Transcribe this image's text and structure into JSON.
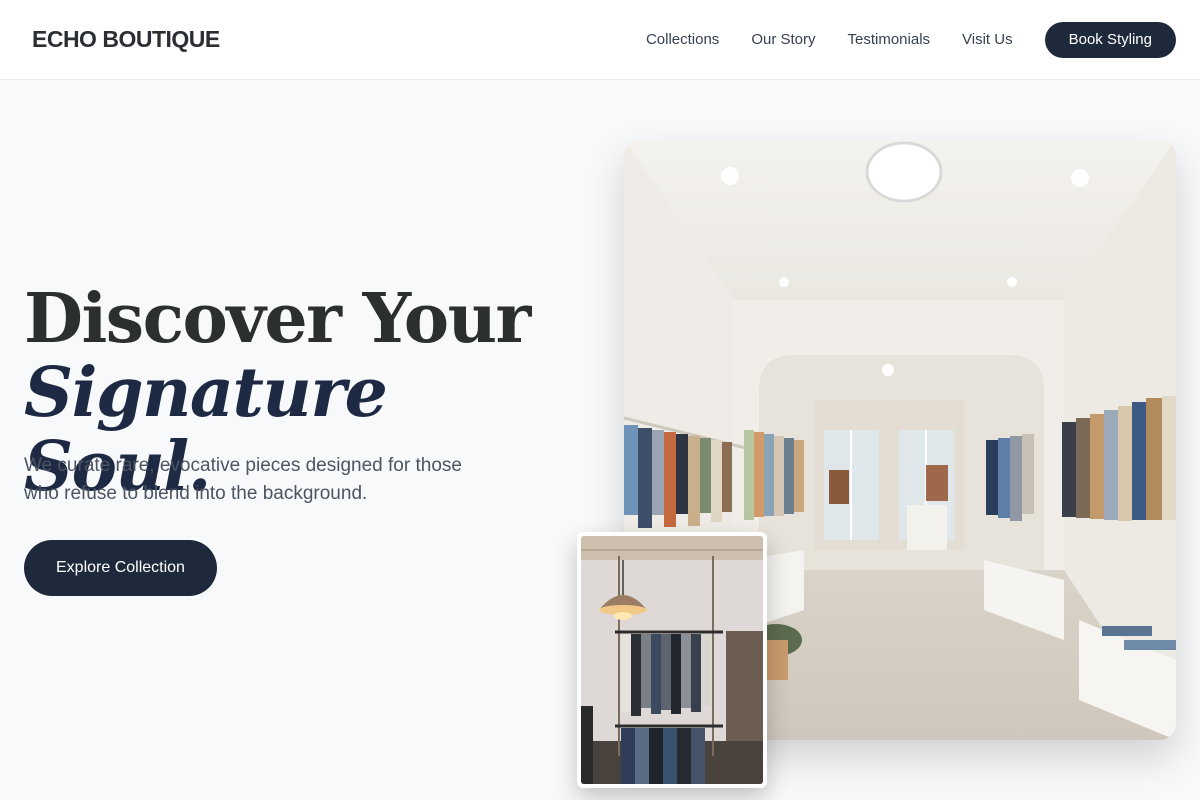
{
  "brand": {
    "name": "ECHO BOUTIQUE"
  },
  "nav": {
    "links": [
      "Collections",
      "Our Story",
      "Testimonials",
      "Visit Us"
    ],
    "cta_label": "Book Styling"
  },
  "hero": {
    "title_line1": "Discover Your",
    "title_line2": "Signature Soul.",
    "subtitle": "We curate rare, evocative pieces designed for those who refuse to blend into the background.",
    "cta_label": "Explore Collection"
  },
  "images": {
    "main": "boutique-interior-photo",
    "secondary": "clothing-rack-photo"
  },
  "colors": {
    "accent": "#1e293b",
    "background": "#f8f9fa",
    "header_bg": "#ffffff",
    "heading": "#2b302f"
  }
}
